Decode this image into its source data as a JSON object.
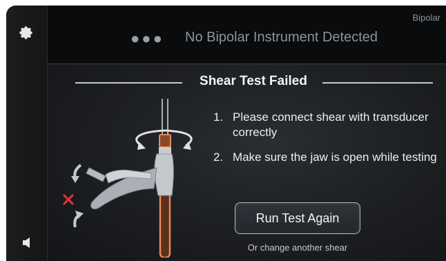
{
  "topbar": {
    "status": "No Bipolar Instrument Detected",
    "mode_label": "Bipolar",
    "menu_dots": "●●●"
  },
  "sidebar": {
    "settings_icon": "gear-icon",
    "volume_icon": "speaker-icon"
  },
  "dialog": {
    "title": "Shear Test Failed",
    "steps": [
      {
        "num": "1.",
        "text": "Please connect shear with transducer correctly"
      },
      {
        "num": "2.",
        "text": "Make sure the jaw is open while testing"
      }
    ],
    "primary_button": "Run Test Again",
    "secondary_link": "Or change another shear",
    "illustration": {
      "error_mark": "✕",
      "colors": {
        "error": "#e0383c",
        "shaft": "#e88a5c",
        "handle": "#c4c9cd"
      }
    }
  }
}
